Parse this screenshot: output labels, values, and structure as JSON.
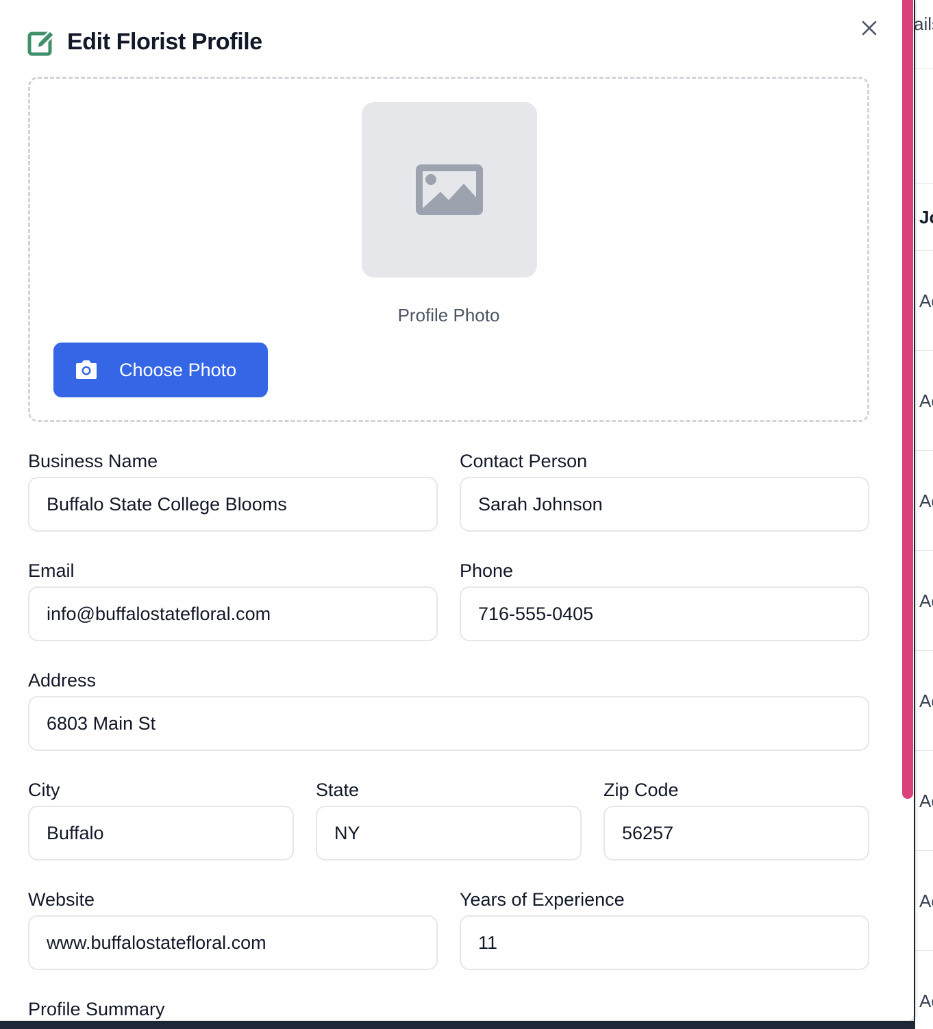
{
  "modal": {
    "title": "Edit Florist Profile",
    "close_symbol": "×"
  },
  "photo": {
    "label": "Profile Photo",
    "button_label": "Choose Photo"
  },
  "fields": {
    "business_name": {
      "label": "Business Name",
      "value": "Buffalo State College Blooms"
    },
    "contact_person": {
      "label": "Contact Person",
      "value": "Sarah Johnson"
    },
    "email": {
      "label": "Email",
      "value": "info@buffalostatefloral.com"
    },
    "phone": {
      "label": "Phone",
      "value": "716-555-0405"
    },
    "address": {
      "label": "Address",
      "value": "6803 Main St"
    },
    "city": {
      "label": "City",
      "value": "Buffalo"
    },
    "state": {
      "label": "State",
      "value": "NY"
    },
    "zip": {
      "label": "Zip Code",
      "value": "56257"
    },
    "website": {
      "label": "Website",
      "value": "www.buffalostatefloral.com"
    },
    "experience": {
      "label": "Years of Experience",
      "value": "11"
    },
    "summary": {
      "label": "Profile Summary"
    }
  },
  "background_table": {
    "header_fragment": "ails",
    "row_fragments": [
      "Jo",
      "Ac",
      "Ac",
      "Ac",
      "Ac",
      "Ac",
      "Ac",
      "Ac",
      "Ac"
    ]
  },
  "colors": {
    "accent": "#3466e6",
    "edit_icon": "#3f8f6b",
    "scrollbar": "#d9427a"
  }
}
